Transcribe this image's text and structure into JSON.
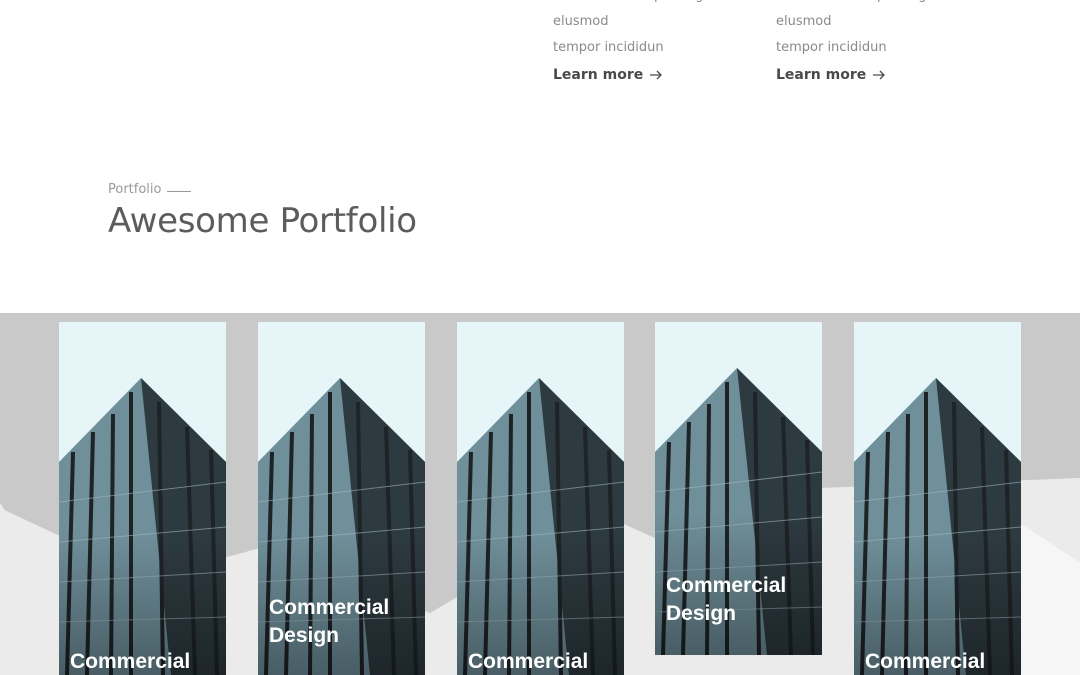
{
  "services": [
    {
      "line1": "consectetur adipisicing elusmod",
      "line2": "tempor incididun",
      "link": "Learn more"
    },
    {
      "line1": "consectetur adipisicing elusmod",
      "line2": "tempor incididun",
      "link": "Learn more"
    }
  ],
  "portfolio": {
    "eyebrow": "Portfolio",
    "title": "Awesome Portfolio",
    "items": [
      {
        "title": "Commercial"
      },
      {
        "title": "Commercial Design"
      },
      {
        "title": "Commercial"
      },
      {
        "title": "Commercial Design"
      },
      {
        "title": "Commercial"
      }
    ]
  },
  "colors": {
    "gallery_bg": "#c9c9c9",
    "gallery_light_shape": "#ebebeb",
    "sky": "#e6f6f8",
    "building_glass": "#6f8f9a",
    "building_dark": "#1e2326"
  }
}
